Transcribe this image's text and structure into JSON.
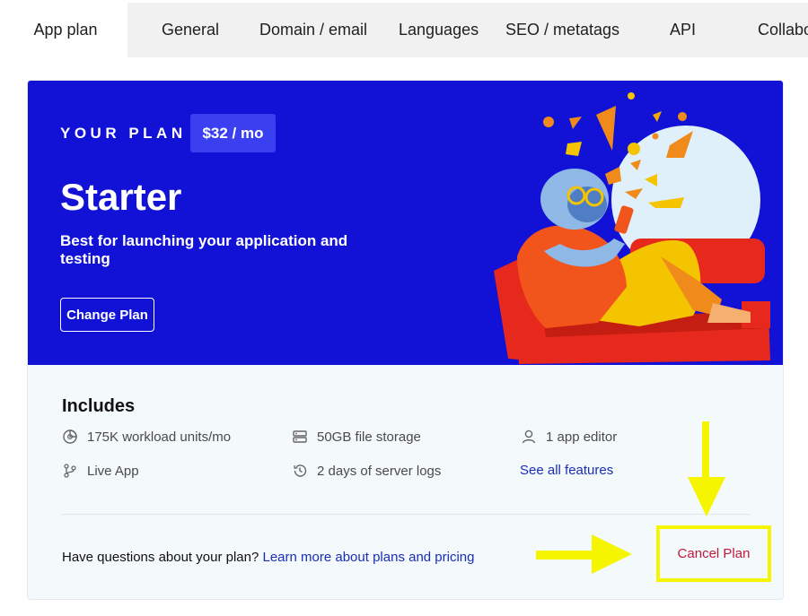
{
  "tabs": [
    {
      "label": "App plan",
      "active": true
    },
    {
      "label": "General"
    },
    {
      "label": "Domain / email"
    },
    {
      "label": "Languages"
    },
    {
      "label": "SEO / metatags"
    },
    {
      "label": "API"
    },
    {
      "label": "Collabo"
    }
  ],
  "plan": {
    "eyebrow": "YOUR PLAN",
    "price": "$32 / mo",
    "name": "Starter",
    "description": "Best for launching your application and testing",
    "change_button": "Change Plan"
  },
  "includes": {
    "title": "Includes",
    "features": [
      {
        "icon": "workload-icon",
        "label": "175K workload units/mo"
      },
      {
        "icon": "storage-icon",
        "label": "50GB file storage"
      },
      {
        "icon": "user-icon",
        "label": "1 app editor"
      },
      {
        "icon": "branch-icon",
        "label": "Live App"
      },
      {
        "icon": "history-icon",
        "label": "2 days of server logs"
      }
    ],
    "see_all": "See all features"
  },
  "footer": {
    "question": "Have questions about your plan?",
    "learn_link": "Learn more about plans and pricing",
    "cancel": "Cancel Plan"
  },
  "colors": {
    "hero_bg": "#1212d6",
    "badge_bg": "#3a3ff0",
    "link": "#1a2eb8",
    "cancel": "#c2183a",
    "highlight": "#f5f500"
  }
}
